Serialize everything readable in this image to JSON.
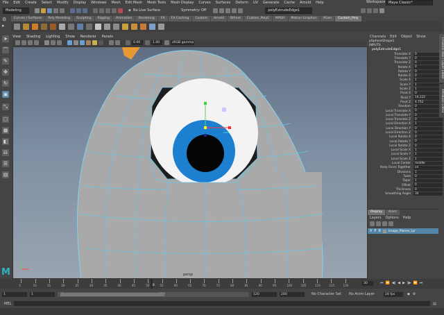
{
  "menubar": {
    "items": [
      "File",
      "Edit",
      "Create",
      "Select",
      "Modify",
      "Display",
      "Windows",
      "Mesh",
      "Edit Mesh",
      "Mesh Tools",
      "Mesh Display",
      "Curves",
      "Surfaces",
      "Deform",
      "UV",
      "Generate",
      "Cache",
      "Arnold",
      "Help"
    ],
    "workspace_label": "Workspace :",
    "workspace_value": "Maya Classic*"
  },
  "statusline": {
    "mode": "Modeling",
    "live_surface": "No Live Surface",
    "symmetry": "Symmetry: Off",
    "object_name": "polyExtrudeEdge1"
  },
  "shelf_tabs": [
    "Curves / Surfaces",
    "Poly Modeling",
    "Sculpting",
    "Rigging",
    "Animation",
    "Rendering",
    "FX",
    "FX Caching",
    "Custom",
    "Arnold",
    "Bifrost",
    "Custom_PolyE",
    "MASH",
    "Motion Graphics",
    "XGen",
    "Custom_Poly"
  ],
  "shelf_active": "Custom_Poly",
  "panel_menu": [
    "View",
    "Shading",
    "Lighting",
    "Show",
    "Renderer",
    "Panels"
  ],
  "panel_toolbar": {
    "val1": "0.00",
    "val2": "1.00",
    "colorspace": "sRGB gamma"
  },
  "viewport": {
    "camera_label": "persp"
  },
  "channel_box": {
    "menu": [
      "Channels",
      "Edit",
      "Object",
      "Show"
    ],
    "shape_name": "pSphereShape1",
    "inputs_label": "INPUTS",
    "node_name": "polyExtrudeEdge1",
    "attributes": [
      {
        "label": "Translate X",
        "value": "0"
      },
      {
        "label": "Translate Y",
        "value": "0"
      },
      {
        "label": "Translate Z",
        "value": "0"
      },
      {
        "label": "Rotate X",
        "value": "0"
      },
      {
        "label": "Rotate Y",
        "value": "0"
      },
      {
        "label": "Rotate Z",
        "value": "0"
      },
      {
        "label": "Scale X",
        "value": "1"
      },
      {
        "label": "Scale Y",
        "value": "1"
      },
      {
        "label": "Scale Z",
        "value": "1"
      },
      {
        "label": "Pivot X",
        "value": "0"
      },
      {
        "label": "Pivot Y",
        "value": "14.222"
      },
      {
        "label": "Pivot Z",
        "value": "4.752"
      },
      {
        "label": "Random",
        "value": "0"
      },
      {
        "label": "Local Translate X",
        "value": "0"
      },
      {
        "label": "Local Translate Y",
        "value": "0"
      },
      {
        "label": "Local Translate Z",
        "value": "0"
      },
      {
        "label": "Local Direction X",
        "value": "1"
      },
      {
        "label": "Local Direction Y",
        "value": "0"
      },
      {
        "label": "Local Direction Z",
        "value": "0"
      },
      {
        "label": "Local Rotate X",
        "value": "0"
      },
      {
        "label": "Local Rotate Y",
        "value": "0"
      },
      {
        "label": "Local Rotate Z",
        "value": "0"
      },
      {
        "label": "Local Scale X",
        "value": "1"
      },
      {
        "label": "Local Scale Y",
        "value": "1"
      },
      {
        "label": "Local Scale Z",
        "value": "1"
      },
      {
        "label": "Local Center",
        "value": "middle"
      },
      {
        "label": "Keep Faces Together",
        "value": "on"
      },
      {
        "label": "Divisions",
        "value": "1"
      },
      {
        "label": "Twist",
        "value": "0"
      },
      {
        "label": "Taper",
        "value": "1"
      },
      {
        "label": "Offset",
        "value": "0"
      },
      {
        "label": "Thickness",
        "value": "0"
      },
      {
        "label": "Smoothing Angle",
        "value": "30"
      }
    ]
  },
  "layer_editor": {
    "tabs": [
      "Display",
      "Anim"
    ],
    "menu": [
      "Layers",
      "Options",
      "Help"
    ],
    "layer_name": "Image_Planes_Lyr"
  },
  "side_tabs": [
    "Channel Box / Layer Editor",
    "Attribute Editor"
  ],
  "timeline": {
    "ticks": [
      "5",
      "10",
      "15",
      "20",
      "25",
      "30",
      "35",
      "40",
      "45",
      "50",
      "55",
      "60",
      "65",
      "70",
      "75",
      "80",
      "85",
      "90",
      "95",
      "100",
      "105",
      "110",
      "115",
      "120"
    ],
    "current_frame": "30",
    "current_frame_field": "30"
  },
  "range": {
    "start": "1",
    "start2": "1",
    "range_start": "1",
    "range_end": "120",
    "end": "120",
    "end2": "200",
    "character_set": "No Character Set",
    "anim_layer": "No Anim Layer",
    "fps": "24 fps"
  },
  "cmdline": {
    "label": "MEL"
  },
  "colors": {
    "accent": "#5285a6",
    "mesh_wire": "#66c8e8",
    "iris": "#1d7fd0",
    "active_tab": "#707070"
  }
}
